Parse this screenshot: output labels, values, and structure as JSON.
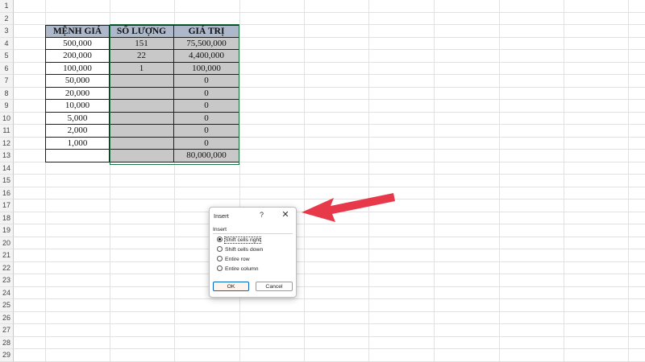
{
  "row_numbers": [
    "1",
    "2",
    "3",
    "4",
    "5",
    "6",
    "7",
    "8",
    "9",
    "10",
    "11",
    "12",
    "13",
    "14",
    "15",
    "16",
    "17",
    "18",
    "19",
    "20",
    "21",
    "22",
    "23",
    "24",
    "25",
    "26",
    "27",
    "28",
    "29"
  ],
  "table": {
    "headers": [
      "MỆNH GIÁ",
      "SỐ LƯỢNG",
      "GIÁ TRỊ"
    ],
    "rows": [
      [
        "500,000",
        "151",
        "75,500,000"
      ],
      [
        "200,000",
        "22",
        "4,400,000"
      ],
      [
        "100,000",
        "1",
        "100,000"
      ],
      [
        "50,000",
        "",
        "0"
      ],
      [
        "20,000",
        "",
        "0"
      ],
      [
        "10,000",
        "",
        "0"
      ],
      [
        "5,000",
        "",
        "0"
      ],
      [
        "2,000",
        "",
        "0"
      ],
      [
        "1,000",
        "",
        "0"
      ],
      [
        "",
        "",
        "80,000,000"
      ]
    ]
  },
  "colors": {
    "header_fill": "#adb9ca",
    "selection_fill": "#c8c8c8",
    "selection_border": "#217346",
    "arrow": "#e8394a"
  },
  "dialog": {
    "title": "Insert",
    "help": "?",
    "close": "✕",
    "group_label": "Insert",
    "options": [
      {
        "label": "Shift cells right",
        "selected": true
      },
      {
        "label": "Shift cells down",
        "selected": false
      },
      {
        "label": "Entire row",
        "selected": false
      },
      {
        "label": "Entire column",
        "selected": false
      }
    ],
    "ok_label": "OK",
    "cancel_label": "Cancel"
  }
}
